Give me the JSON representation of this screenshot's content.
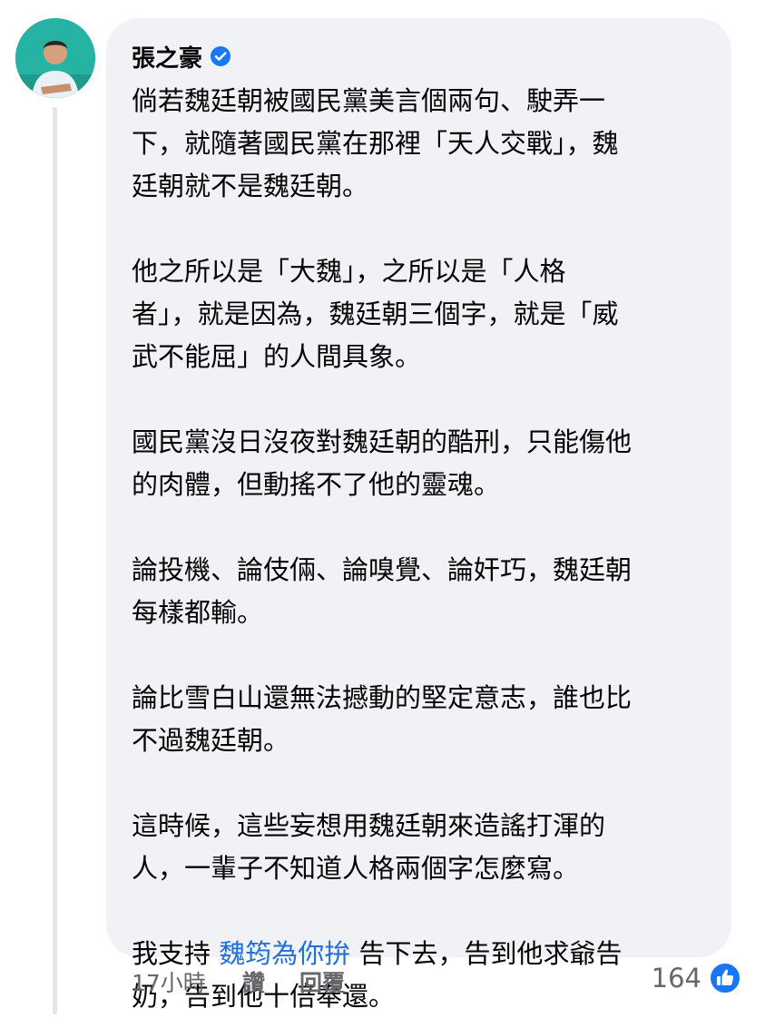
{
  "comment": {
    "author": "張之豪",
    "paragraphs": [
      {
        "lines": [
          [
            {
              "text": "倘若魏廷朝被國民黨美言個兩句、駛弄一"
            }
          ],
          [
            {
              "text": "下，就隨著國民黨在那裡「天人交戰」，魏"
            }
          ],
          [
            {
              "text": "廷朝就不是魏廷朝。"
            }
          ]
        ]
      },
      {
        "lines": [
          [
            {
              "text": "他之所以是「大魏」，之所以是「人格"
            }
          ],
          [
            {
              "text": "者」，就是因為，魏廷朝三個字，就是「威"
            }
          ],
          [
            {
              "text": "武不能屈」的人間具象。"
            }
          ]
        ]
      },
      {
        "lines": [
          [
            {
              "text": "國民黨沒日沒夜對魏廷朝的酷刑，只能傷他"
            }
          ],
          [
            {
              "text": "的肉體，但動搖不了他的靈魂。"
            }
          ]
        ]
      },
      {
        "lines": [
          [
            {
              "text": "論投機、論伎倆、論嗅覺、論奸巧，魏廷朝"
            }
          ],
          [
            {
              "text": "每樣都輸。"
            }
          ]
        ]
      },
      {
        "lines": [
          [
            {
              "text": "論比雪白山還無法撼動的堅定意志，誰也比"
            }
          ],
          [
            {
              "text": "不過魏廷朝。"
            }
          ]
        ]
      },
      {
        "lines": [
          [
            {
              "text": "這時候，這些妄想用魏廷朝來造謠打渾的"
            }
          ],
          [
            {
              "text": "人，一輩子不知道人格兩個字怎麼寫。"
            }
          ]
        ]
      },
      {
        "lines": [
          [
            {
              "text": "我支持 "
            },
            {
              "text": "魏筠為你拚",
              "link": true
            },
            {
              "text": " 告下去，告到他求爺告"
            }
          ],
          [
            {
              "text": "奶，告到他十倍奉還。"
            }
          ]
        ]
      }
    ],
    "time": "17小時",
    "actions": [
      "讚",
      "回覆"
    ],
    "reaction_count": "164",
    "colors": {
      "mention": "#216fdb",
      "like": "#1877f2",
      "verified": "#1877f2"
    }
  },
  "icons": {
    "verified": "verified-badge-icon",
    "like": "like-thumb-icon"
  }
}
